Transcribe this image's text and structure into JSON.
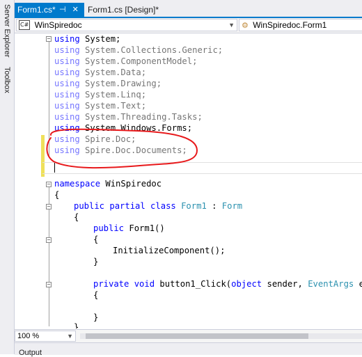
{
  "side_rail": {
    "server_explorer": "Server Explorer",
    "toolbox": "Toolbox"
  },
  "tabs": [
    {
      "label": "Form1.cs*",
      "active": true
    },
    {
      "label": "Form1.cs [Design]*",
      "active": false
    }
  ],
  "tab_icons": {
    "pin": "pin-icon",
    "close": "close-icon"
  },
  "navbar": {
    "project_badge": "C#",
    "project": "WinSpiredoc",
    "type": "WinSpiredoc.Form1"
  },
  "code": {
    "usings": [
      {
        "kw": "using",
        "ns": " System;"
      },
      {
        "kw": "using",
        "ns": " System.Collections.Generic;"
      },
      {
        "kw": "using",
        "ns": " System.ComponentModel;"
      },
      {
        "kw": "using",
        "ns": " System.Data;"
      },
      {
        "kw": "using",
        "ns": " System.Drawing;"
      },
      {
        "kw": "using",
        "ns": " System.Linq;"
      },
      {
        "kw": "using",
        "ns": " System.Text;"
      },
      {
        "kw": "using",
        "ns": " System.Threading.Tasks;"
      },
      {
        "kw": "using",
        "ns": " System.Windows.Forms;"
      },
      {
        "kw": "using",
        "ns": " Spire.Doc;"
      },
      {
        "kw": "using",
        "ns": " Spire.Doc.Documents;"
      }
    ],
    "ns_kw": "namespace",
    "ns_name": " WinSpiredoc",
    "open_brace": "{",
    "close_brace": "}",
    "class_decl": {
      "mods": "public partial class",
      "name": "Form1",
      "colon": " : ",
      "base": "Form"
    },
    "ctor": {
      "mod": "public",
      "name": " Form1()"
    },
    "init_call": "InitializeComponent();",
    "method": {
      "mods": "private void",
      "name": " button1_Click(",
      "objkw": "object",
      "p1": " sender, ",
      "argtype": "EventArgs",
      "p2": " e)"
    }
  },
  "zoom": "100 %",
  "output_label": "Output",
  "colors": {
    "accent": "#007acc",
    "keyword": "#0000ff",
    "type": "#2b91af",
    "annotation": "#e8191b",
    "change_bar": "#efe05a"
  }
}
